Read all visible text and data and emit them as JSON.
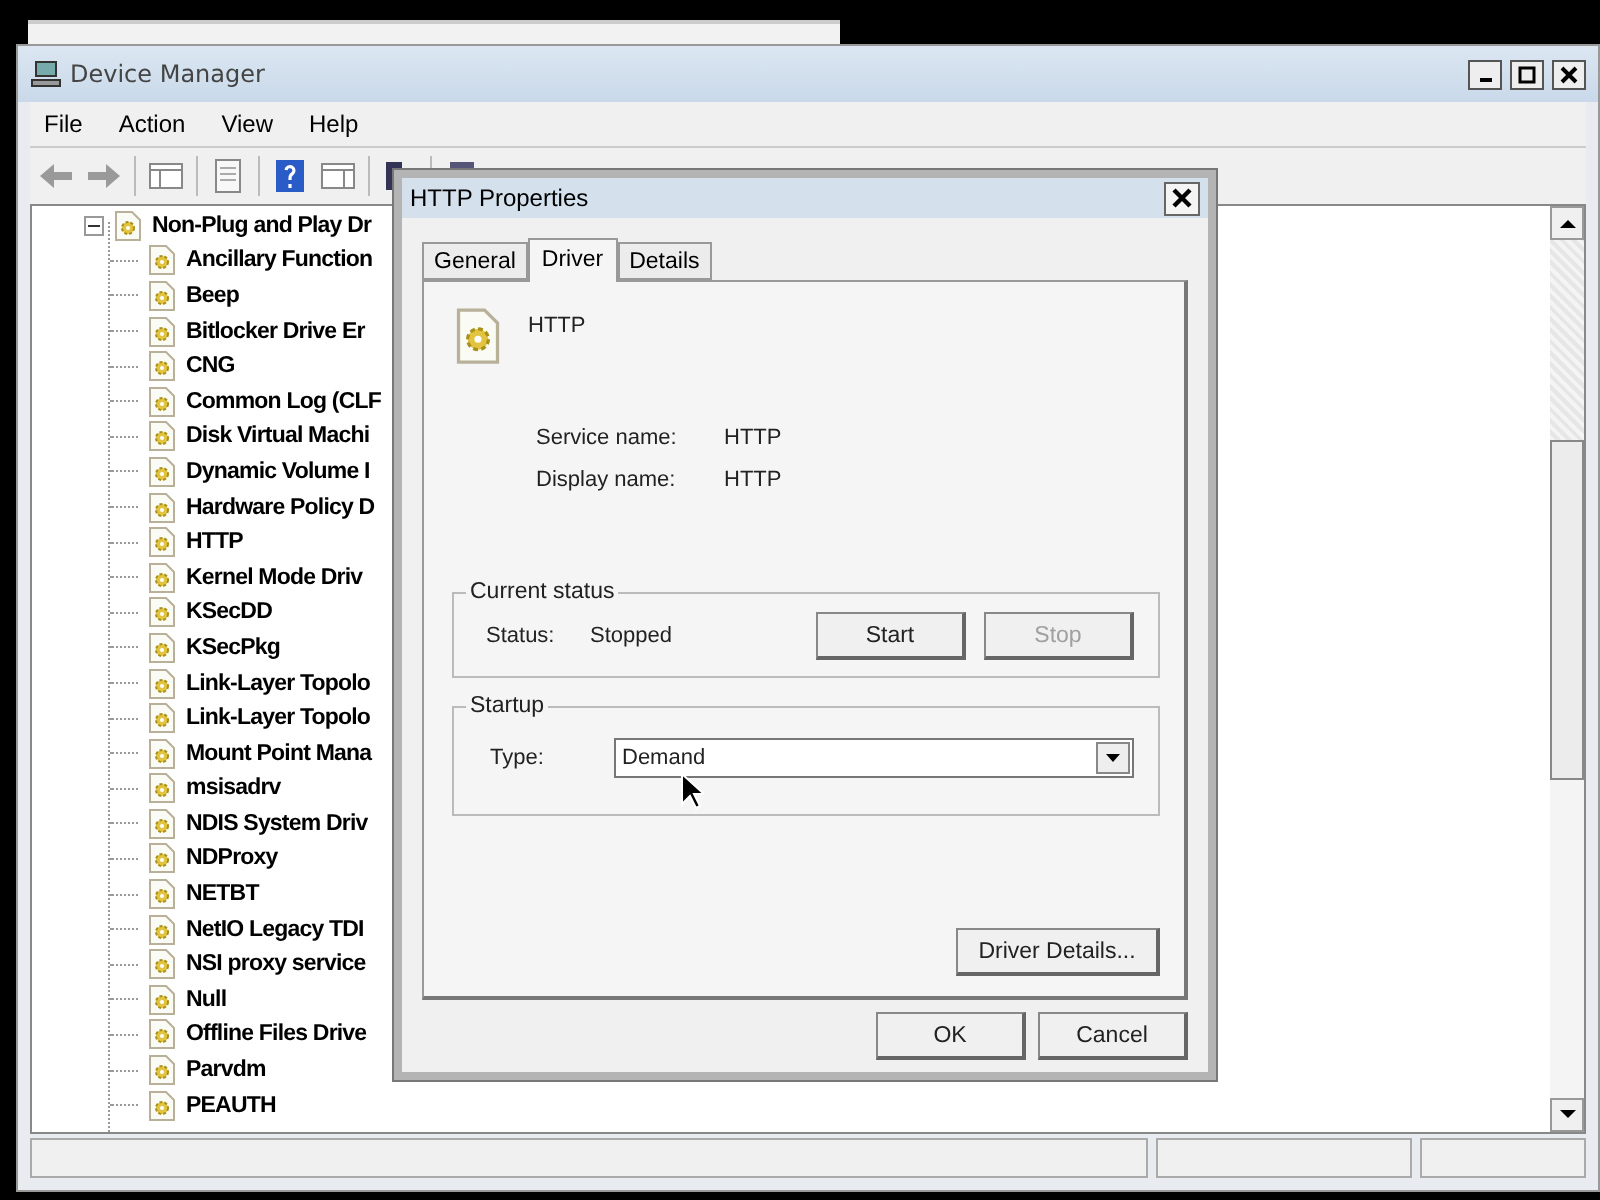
{
  "window": {
    "title": "Device Manager"
  },
  "menu": [
    "File",
    "Action",
    "View",
    "Help"
  ],
  "tree": {
    "items": [
      {
        "label": "Non-Plug and Play Dr",
        "expanded": true,
        "children": [
          {
            "label": "Ancillary Function"
          },
          {
            "label": "Beep"
          },
          {
            "label": "Bitlocker Drive Er"
          },
          {
            "label": "CNG"
          },
          {
            "label": "Common Log (CLF"
          },
          {
            "label": "Disk Virtual Machi"
          },
          {
            "label": "Dynamic Volume I"
          },
          {
            "label": "Hardware Policy D"
          },
          {
            "label": "HTTP"
          },
          {
            "label": "Kernel Mode Driv"
          },
          {
            "label": "KSecDD"
          },
          {
            "label": "KSecPkg"
          },
          {
            "label": "Link-Layer Topolo"
          },
          {
            "label": "Link-Layer Topolo"
          },
          {
            "label": "Mount Point Mana"
          },
          {
            "label": "msisadrv"
          },
          {
            "label": "NDIS System Driv"
          },
          {
            "label": "NDProxy"
          },
          {
            "label": "NETBT"
          },
          {
            "label": "NetIO Legacy TDI"
          },
          {
            "label": "NSI proxy service"
          },
          {
            "label": "Null"
          },
          {
            "label": "Offline Files Drive"
          },
          {
            "label": "Parvdm"
          },
          {
            "label": "PEAUTH"
          }
        ]
      }
    ]
  },
  "dialog": {
    "title": "HTTP Properties",
    "tabs": [
      {
        "label": "General",
        "selected": false
      },
      {
        "label": "Driver",
        "selected": true
      },
      {
        "label": "Details",
        "selected": false
      }
    ],
    "driver_name": "HTTP",
    "fields": [
      {
        "label": "Service name:",
        "value": "HTTP"
      },
      {
        "label": "Display name:",
        "value": "HTTP"
      }
    ],
    "current_status": {
      "legend": "Current status",
      "label": "Status:",
      "value": "Stopped",
      "buttons": [
        {
          "label": "Start",
          "disabled": false
        },
        {
          "label": "Stop",
          "disabled": true
        }
      ]
    },
    "startup": {
      "legend": "Startup",
      "label": "Type:",
      "value": "Demand"
    },
    "details_button": "Driver Details...",
    "buttons": [
      "OK",
      "Cancel"
    ]
  }
}
